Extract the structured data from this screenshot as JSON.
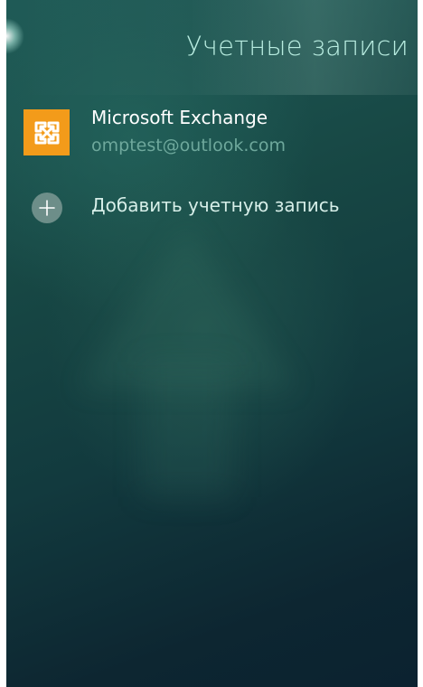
{
  "header": {
    "title": "Учетные записи"
  },
  "accounts": [
    {
      "icon": "microsoft-exchange-icon",
      "name": "Microsoft Exchange",
      "email": "omptest@outlook.com"
    }
  ],
  "add_account": {
    "icon": "plus-icon",
    "label": "Добавить учетную запись"
  },
  "colors": {
    "accent_title": "#b8ece0",
    "exchange_orange": "#f39b1a",
    "secondary_text": "#6ea89c"
  }
}
